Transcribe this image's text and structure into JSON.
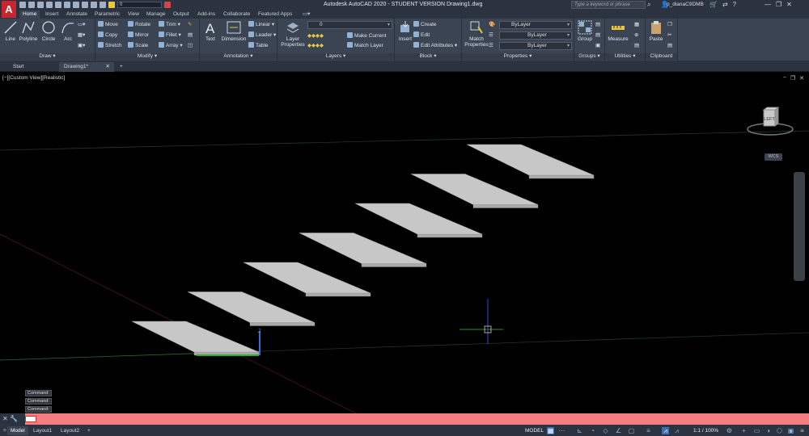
{
  "app": {
    "logo_letter": "A",
    "title": "Autodesk AutoCAD 2020 - STUDENT VERSION    Drawing1.dwg",
    "search_placeholder": "Type a keyword or phrase",
    "user": "p_dianaC9DMB",
    "qat_layer": "0"
  },
  "ribbon_tabs": [
    "Home",
    "Insert",
    "Annotate",
    "Parametric",
    "View",
    "Manage",
    "Output",
    "Add-ins",
    "Collaborate",
    "Featured Apps"
  ],
  "ribbon": {
    "draw": {
      "label": "Draw",
      "line": "Line",
      "polyline": "Polyline",
      "circle": "Circle",
      "arc": "Arc"
    },
    "modify": {
      "label": "Modify",
      "move": "Move",
      "rotate": "Rotate",
      "trim": "Trim",
      "copy": "Copy",
      "mirror": "Mirror",
      "fillet": "Fillet",
      "stretch": "Stretch",
      "scale": "Scale",
      "array": "Array"
    },
    "annotation": {
      "label": "Annotation",
      "text": "Text",
      "dimension": "Dimension",
      "linear": "Linear",
      "leader": "Leader",
      "table": "Table"
    },
    "layers": {
      "label": "Layers",
      "layer_properties": "Layer Properties",
      "current_layer": "0",
      "make_current": "Make Current",
      "match_layer": "Match Layer"
    },
    "block": {
      "label": "Block",
      "insert": "Insert",
      "create": "Create",
      "edit": "Edit",
      "edit_attributes": "Edit Attributes"
    },
    "properties": {
      "label": "Properties",
      "match_properties": "Match Properties",
      "color": "ByLayer",
      "linetype": "ByLayer",
      "lineweight": "ByLayer"
    },
    "groups": {
      "label": "Groups",
      "group": "Group"
    },
    "utilities": {
      "label": "Utilities",
      "measure": "Measure"
    },
    "clipboard": {
      "label": "Clipboard",
      "paste": "Paste"
    }
  },
  "file_tabs": [
    "Start",
    "Drawing1*"
  ],
  "viewport": {
    "view_label": "[−][Custom View][Realistic]",
    "viewcube_face": "LEFT",
    "wcs": "WCS"
  },
  "command_history": [
    "Command:",
    "Command:",
    "Command:"
  ],
  "status": {
    "layout_tabs": [
      "Model",
      "Layout1",
      "Layout2"
    ],
    "model": "MODEL",
    "scale": "1:1 / 100%"
  }
}
